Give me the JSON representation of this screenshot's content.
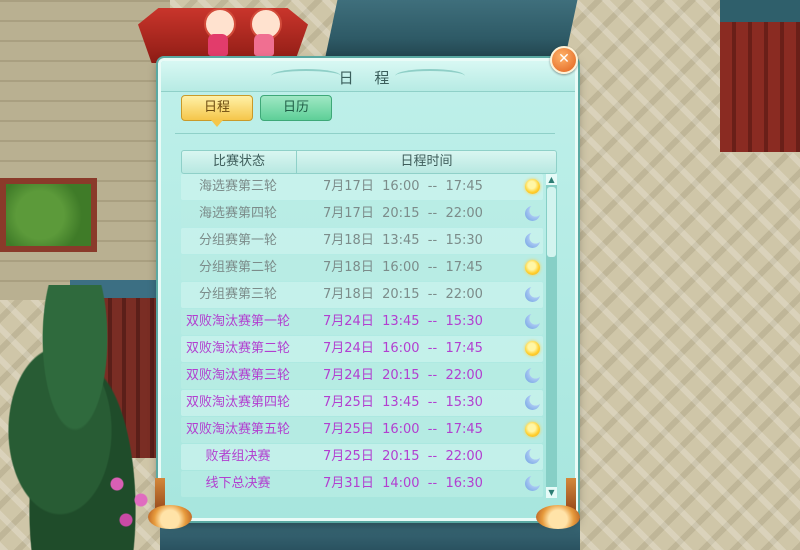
{
  "window": {
    "title": "日  程",
    "close_label": "✕"
  },
  "tabs": [
    {
      "label": "日程",
      "active": true
    },
    {
      "label": "日历",
      "active": false
    }
  ],
  "table": {
    "headers": {
      "status": "比赛状态",
      "time": "日程时间"
    },
    "rows": [
      {
        "name": "海选赛第三轮",
        "time": "7月17日  16:00  --  17:45",
        "icon": "sun-icon",
        "highlight": false
      },
      {
        "name": "海选赛第四轮",
        "time": "7月17日  20:15  --  22:00",
        "icon": "moon-icon",
        "highlight": false
      },
      {
        "name": "分组赛第一轮",
        "time": "7月18日  13:45  --  15:30",
        "icon": "moon-icon",
        "highlight": false
      },
      {
        "name": "分组赛第二轮",
        "time": "7月18日  16:00  --  17:45",
        "icon": "sun-icon",
        "highlight": false
      },
      {
        "name": "分组赛第三轮",
        "time": "7月18日  20:15  --  22:00",
        "icon": "moon-icon",
        "highlight": false
      },
      {
        "name": "双败淘汰赛第一轮",
        "time": "7月24日  13:45  --  15:30",
        "icon": "moon-icon",
        "highlight": true
      },
      {
        "name": "双败淘汰赛第二轮",
        "time": "7月24日  16:00  --  17:45",
        "icon": "sun-icon",
        "highlight": true
      },
      {
        "name": "双败淘汰赛第三轮",
        "time": "7月24日  20:15  --  22:00",
        "icon": "moon-icon",
        "highlight": true
      },
      {
        "name": "双败淘汰赛第四轮",
        "time": "7月25日  13:45  --  15:30",
        "icon": "moon-icon",
        "highlight": true
      },
      {
        "name": "双败淘汰赛第五轮",
        "time": "7月25日  16:00  --  17:45",
        "icon": "sun-icon",
        "highlight": true
      },
      {
        "name": "败者组决赛",
        "time": "7月25日  20:15  --  22:00",
        "icon": "moon-icon",
        "highlight": true
      },
      {
        "name": "线下总决赛",
        "time": "7月31日  14:00  --  16:30",
        "icon": "moon-icon",
        "highlight": true
      }
    ]
  },
  "scrollbar": {
    "up_arrow": "▲",
    "down_arrow": "▼"
  },
  "colors": {
    "panel_bg": "#a7e6de",
    "completed_text": "#7c8c8a",
    "upcoming_text": "#b23fd0",
    "active_tab": "#f5c64a",
    "inactive_tab": "#5ecf98"
  }
}
